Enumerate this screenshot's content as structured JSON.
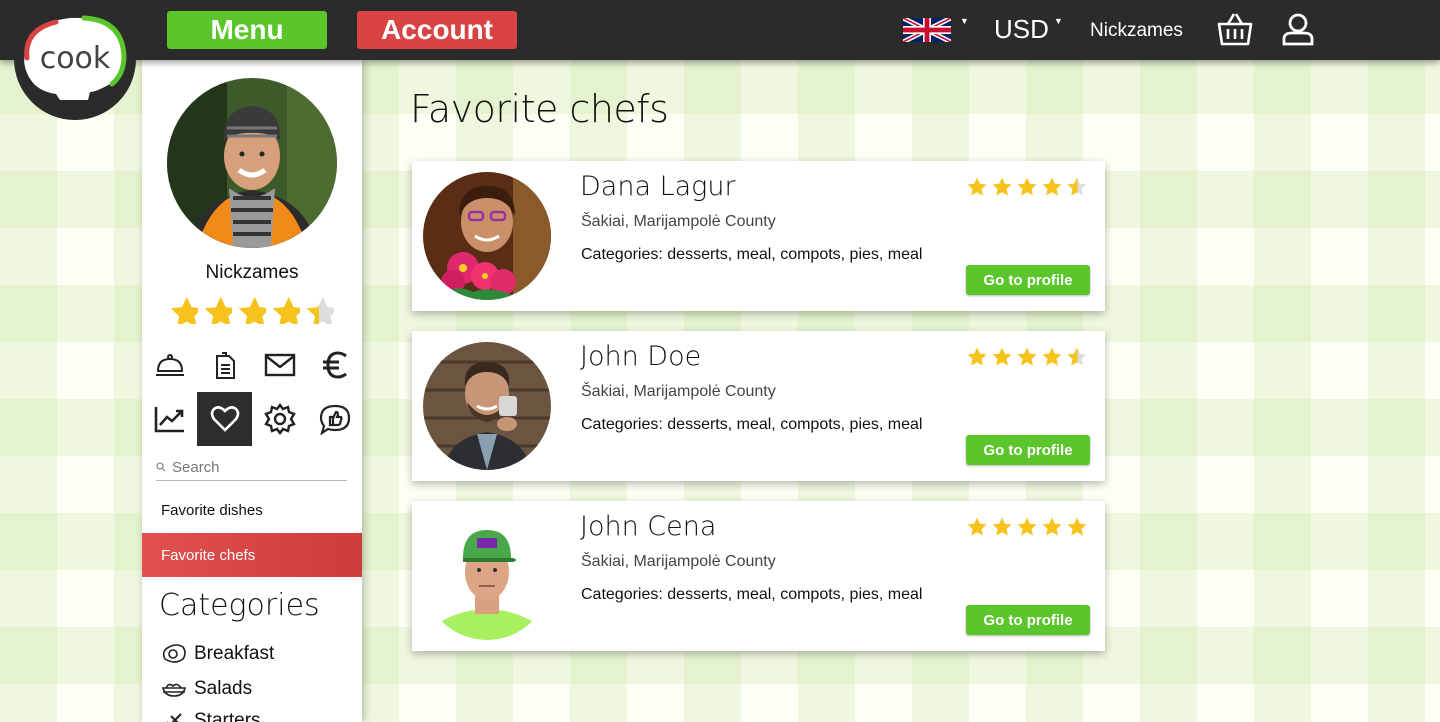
{
  "brand": {
    "logo_text": "cook"
  },
  "topbar": {
    "menu_label": "Menu",
    "account_label": "Account",
    "currency": "USD",
    "username": "Nickzames",
    "language_flag": "uk-flag-icon",
    "basket_icon": "basket-icon",
    "user_icon": "user-icon",
    "colors": {
      "bar": "#2b2b2b",
      "menu": "#5bc52c",
      "account": "#d84444"
    }
  },
  "sidebar": {
    "username": "Nickzames",
    "rating": 4.5,
    "icons": [
      "cloche-icon",
      "document-icon",
      "mail-icon",
      "euro-icon",
      "chart-icon",
      "heart-icon",
      "gear-icon",
      "chat-like-icon"
    ],
    "active_icon": "heart-icon",
    "search_placeholder": "Search",
    "links": [
      {
        "label": "Favorite dishes",
        "active": false
      },
      {
        "label": "Favorite chefs",
        "active": true
      }
    ],
    "categories_title": "Categories",
    "categories": [
      {
        "label": "Breakfast",
        "icon": "egg-icon"
      },
      {
        "label": "Salads",
        "icon": "salad-bowl-icon"
      },
      {
        "label": "Starters",
        "icon": "starters-icon"
      }
    ]
  },
  "main": {
    "title": "Favorite chefs",
    "chefs": [
      {
        "name": "Dana Lagur",
        "location": "Šakiai,  Marijampolė County",
        "categories": "Categories: desserts, meal, compots, pies, meal",
        "rating": 4.5,
        "button": "Go to profile"
      },
      {
        "name": "John Doe",
        "location": "Šakiai,  Marijampolė County",
        "categories": "Categories: desserts, meal, compots, pies, meal",
        "rating": 4.5,
        "button": "Go to profile"
      },
      {
        "name": "John Cena",
        "location": "Šakiai,  Marijampolė County",
        "categories": "Categories: desserts, meal, compots, pies, meal",
        "rating": 5,
        "button": "Go to profile"
      }
    ]
  }
}
